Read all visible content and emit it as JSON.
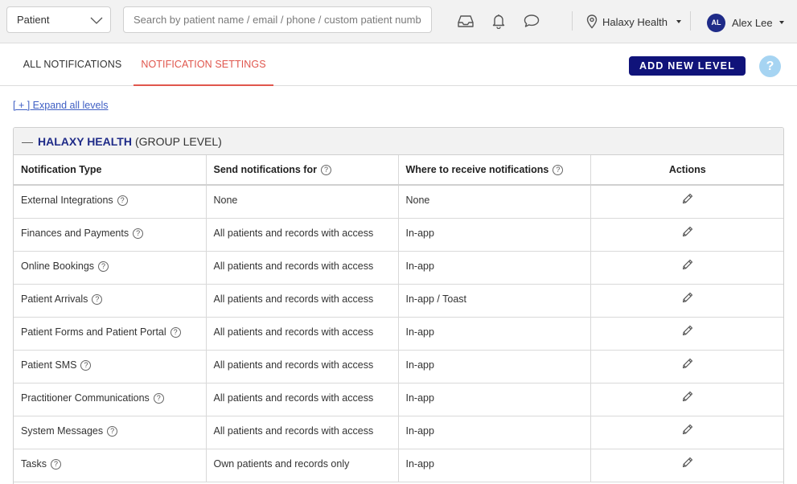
{
  "topbar": {
    "search_type": "Patient",
    "search_placeholder": "Search by patient name / email / phone / custom patient number",
    "icons": [
      "inbox-icon",
      "bell-icon",
      "chat-icon",
      "location-pin-icon"
    ],
    "org_name": "Halaxy Health",
    "user_initials": "AL",
    "user_name": "Alex Lee"
  },
  "tabs": [
    {
      "label": "ALL NOTIFICATIONS",
      "active": false
    },
    {
      "label": "NOTIFICATION SETTINGS",
      "active": true
    }
  ],
  "actions": {
    "add_level_label": "ADD NEW LEVEL",
    "help_label": "?"
  },
  "expand_label": "[ + ] Expand all levels",
  "panel": {
    "collapse_symbol": "—",
    "org_name": "HALAXY HEALTH",
    "level": "(GROUP LEVEL)",
    "columns": [
      "Notification Type",
      "Send notifications for",
      "Where to receive notifications",
      "Actions"
    ],
    "rows": [
      {
        "type": "External Integrations",
        "send_for": "None",
        "where": "None"
      },
      {
        "type": "Finances and Payments",
        "send_for": "All patients and records with access",
        "where": "In-app"
      },
      {
        "type": "Online Bookings",
        "send_for": "All patients and records with access",
        "where": "In-app"
      },
      {
        "type": "Patient Arrivals",
        "send_for": "All patients and records with access",
        "where": "In-app / Toast"
      },
      {
        "type": "Patient Forms and Patient Portal",
        "send_for": "All patients and records with access",
        "where": "In-app"
      },
      {
        "type": "Patient SMS",
        "send_for": "All patients and records with access",
        "where": "In-app"
      },
      {
        "type": "Practitioner Communications",
        "send_for": "All patients and records with access",
        "where": "In-app"
      },
      {
        "type": "System Messages",
        "send_for": "All patients and records with access",
        "where": "In-app"
      },
      {
        "type": "Tasks",
        "send_for": "Own patients and records only",
        "where": "In-app"
      }
    ]
  },
  "colors": {
    "brand_navy": "#1f2b88",
    "button_navy": "#10137a",
    "active_tab": "#e0564d",
    "link": "#3f5fc4",
    "help_bubble": "#a6d4f2"
  }
}
